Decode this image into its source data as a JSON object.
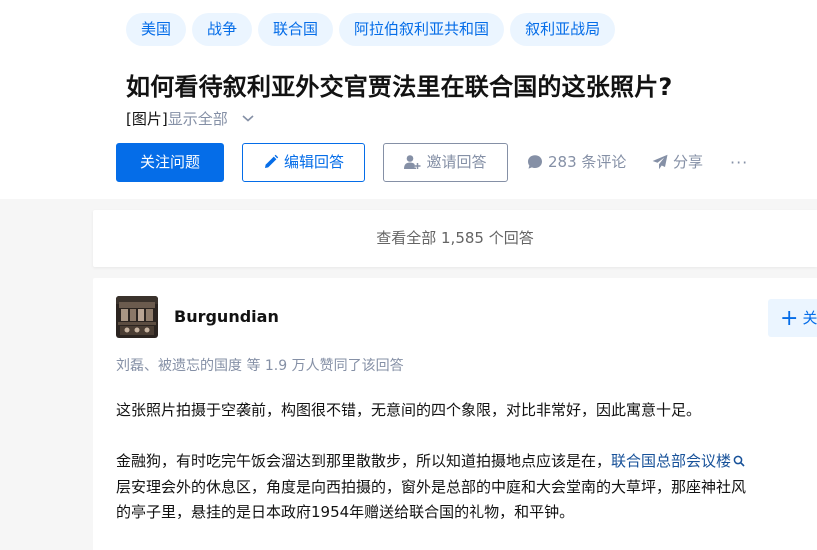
{
  "question": {
    "topics": [
      "美国",
      "战争",
      "联合国",
      "阿拉伯叙利亚共和国",
      "叙利亚战局"
    ],
    "title": "如何看待叙利亚外交官贾法里在联合国的这张照片?",
    "image_tag": "[图片]",
    "show_all": "显示全部"
  },
  "actions": {
    "follow": "关注问题",
    "edit": "编辑回答",
    "invite": "邀请回答",
    "comments": "283 条评论",
    "share": "分享",
    "more": "···"
  },
  "view_all": "查看全部 1,585 个回答",
  "answer": {
    "author": "Burgundian",
    "follow_button": "关",
    "voters": "刘磊、被遗忘的国度 等 1.9 万人赞同了该回答",
    "para1": "这张照片拍摄于空袭前，构图很不错，无意间的四个象限，对比非常好，因此寓意十足。",
    "para2_start": "金融狗，有时吃完午饭会溜达到那里散散步，所以知道拍摄地点应该是在，",
    "para2_link": "联合国总部会议楼",
    "para2_line2": "层安理会外的休息区，角度是向西拍摄的，窗外是总部的中庭和大会堂南的大草坪，那座神社风",
    "para2_line3": "的亭子里，悬挂的是日本政府1954年赠送给联合国的礼物，和平钟。"
  },
  "colors": {
    "brand": "#056de8",
    "topic_bg": "#ebf5ff",
    "muted": "#8590a6",
    "link": "#175199"
  }
}
